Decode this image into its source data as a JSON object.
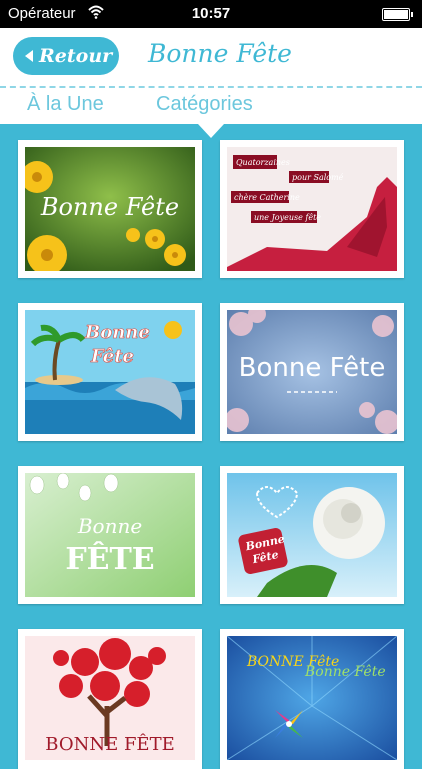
{
  "status_bar": {
    "carrier": "Opérateur",
    "time": "10:57"
  },
  "nav": {
    "back_label": "Retour",
    "title": "Bonne Fête"
  },
  "tabs": [
    {
      "label": "À la Une",
      "active": false
    },
    {
      "label": "Catégories",
      "active": true
    }
  ],
  "cards": [
    {
      "caption": "Bonne Fête"
    },
    {
      "caption_lines": [
        "Quatorzaines",
        "pour Salomé",
        "chère Catherine",
        "une Joyeuse fête"
      ]
    },
    {
      "caption_lines": [
        "Bonne",
        "Fête"
      ]
    },
    {
      "caption": "Bonne Fête"
    },
    {
      "caption_lines": [
        "Bonne",
        "FÊTE"
      ]
    },
    {
      "caption_lines": [
        "Bonne",
        "Fête"
      ]
    },
    {
      "caption": "BONNE FÊTE"
    },
    {
      "caption_lines": [
        "BONNE Fête",
        "Bonne Fête"
      ]
    }
  ],
  "colors": {
    "accent": "#3fb8d4",
    "header_bg": "#ffffff"
  }
}
